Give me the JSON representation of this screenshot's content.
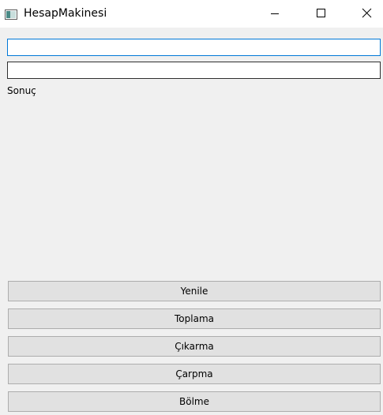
{
  "window": {
    "title": "HesapMakinesi",
    "icon": "app-window-icon",
    "controls": {
      "minimize_icon": "minimize-icon",
      "maximize_icon": "maximize-icon",
      "close_icon": "close-icon"
    }
  },
  "form": {
    "first_number": {
      "value": "",
      "placeholder": ""
    },
    "second_number": {
      "value": "",
      "placeholder": ""
    },
    "result_label": "Sonuç"
  },
  "buttons": {
    "refresh": "Yenile",
    "add": "Toplama",
    "subtract": "Çıkarma",
    "multiply": "Çarpma",
    "divide": "Bölme"
  },
  "colors": {
    "background": "#f0f0f0",
    "focus_border": "#0078d7",
    "button_face": "#e1e1e1"
  }
}
